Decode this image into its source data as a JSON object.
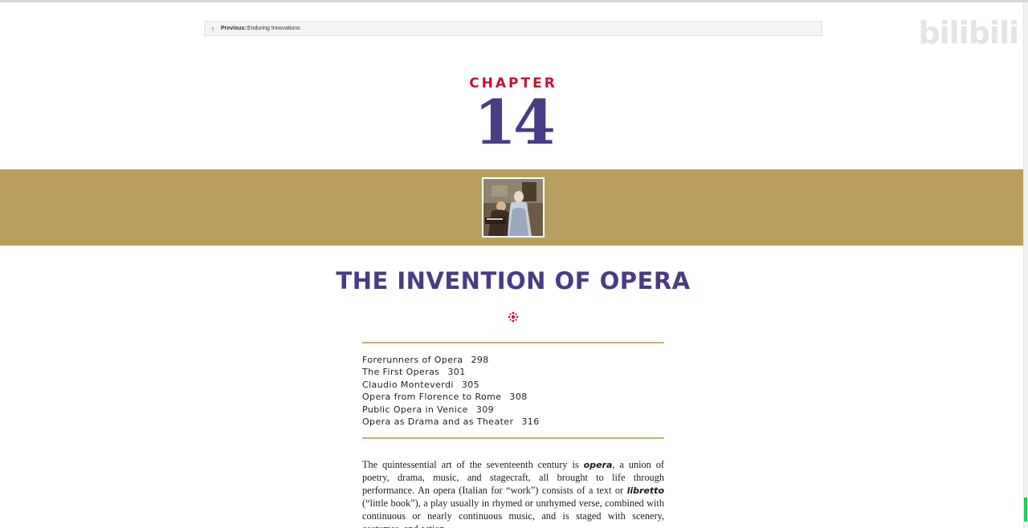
{
  "nav": {
    "previous_label": "Previous:",
    "previous_title": "Enduring Innovations",
    "arrow_icon": "arrow-up-icon"
  },
  "watermark": {
    "blurred_text": "",
    "logo_text": "bilibili"
  },
  "chapter": {
    "label": "CHAPTER",
    "number": "14"
  },
  "title": "THE INVENTION OF OPERA",
  "toc": [
    {
      "title": "Forerunners of Opera",
      "page": "298"
    },
    {
      "title": "The First Operas",
      "page": "301"
    },
    {
      "title": "Claudio Monteverdi",
      "page": "305"
    },
    {
      "title": "Opera from Florence to Rome",
      "page": "308"
    },
    {
      "title": "Public Opera in Venice",
      "page": "309"
    },
    {
      "title": "Opera as Drama and as Theater",
      "page": "316"
    }
  ],
  "body": {
    "p1_a": "The quintessential art of the seventeenth century is ",
    "p1_term1": "opera",
    "p1_b": ", a union of poetry, drama, music, and stagecraft, all brought to life through performance. An opera (Italian for “work”) consists of a text or ",
    "p1_term2": "libretto",
    "p1_c": " (“little book”), a play usually in rhymed or unrhymed verse, combined with continuous or nearly continuous music, and is staged with scenery, costumes, and action."
  },
  "colors": {
    "chapter_label": "#c8102e",
    "accent_purple": "#4a3b86",
    "gold_band": "#b89f60",
    "rule": "#c2b07e",
    "scroll_thumb": "#1fd24f"
  }
}
